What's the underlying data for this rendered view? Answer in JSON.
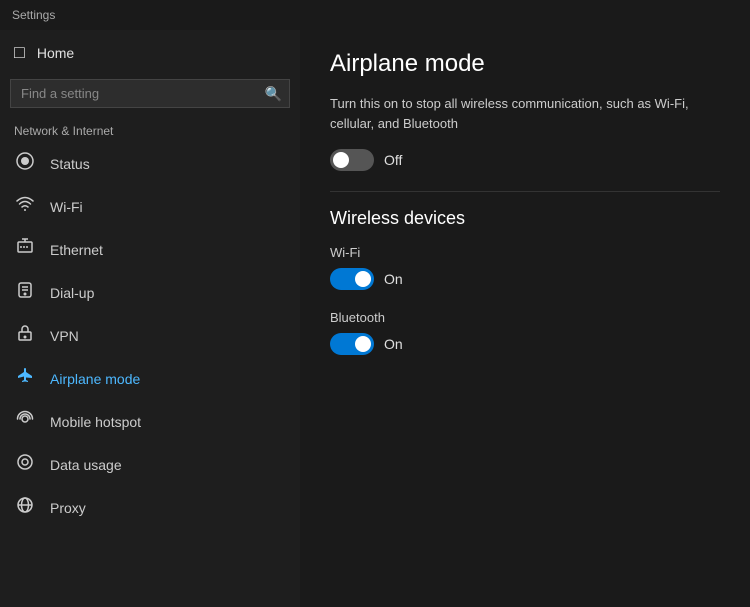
{
  "titlebar": {
    "label": "Settings"
  },
  "sidebar": {
    "home_label": "Home",
    "search_placeholder": "Find a setting",
    "section_label": "Network & Internet",
    "items": [
      {
        "id": "status",
        "label": "Status",
        "icon": "🌐"
      },
      {
        "id": "wifi",
        "label": "Wi-Fi",
        "icon": "📶"
      },
      {
        "id": "ethernet",
        "label": "Ethernet",
        "icon": "🖧"
      },
      {
        "id": "dialup",
        "label": "Dial-up",
        "icon": "📞"
      },
      {
        "id": "vpn",
        "label": "VPN",
        "icon": "🔒"
      },
      {
        "id": "airplane",
        "label": "Airplane mode",
        "icon": "✈"
      },
      {
        "id": "hotspot",
        "label": "Mobile hotspot",
        "icon": "📡"
      },
      {
        "id": "datausage",
        "label": "Data usage",
        "icon": "📊"
      },
      {
        "id": "proxy",
        "label": "Proxy",
        "icon": "🌐"
      }
    ]
  },
  "content": {
    "page_title": "Airplane mode",
    "description": "Turn this on to stop all wireless communication, such as Wi-Fi, cellular, and Bluetooth",
    "airplane_toggle": {
      "state": "off",
      "label": "Off"
    },
    "wireless_section_title": "Wireless devices",
    "wifi_label": "Wi-Fi",
    "wifi_toggle": {
      "state": "on",
      "label": "On"
    },
    "bluetooth_label": "Bluetooth",
    "bluetooth_toggle": {
      "state": "on",
      "label": "On"
    }
  },
  "icons": {
    "home": "⊞",
    "search": "🔍",
    "globe": "🌐",
    "wifi": "▲",
    "ethernet": "🔌",
    "dialup": "☎",
    "vpn": "🔑",
    "airplane": "✈",
    "hotspot": "◉",
    "datausage": "◎",
    "proxy": "🌐"
  }
}
